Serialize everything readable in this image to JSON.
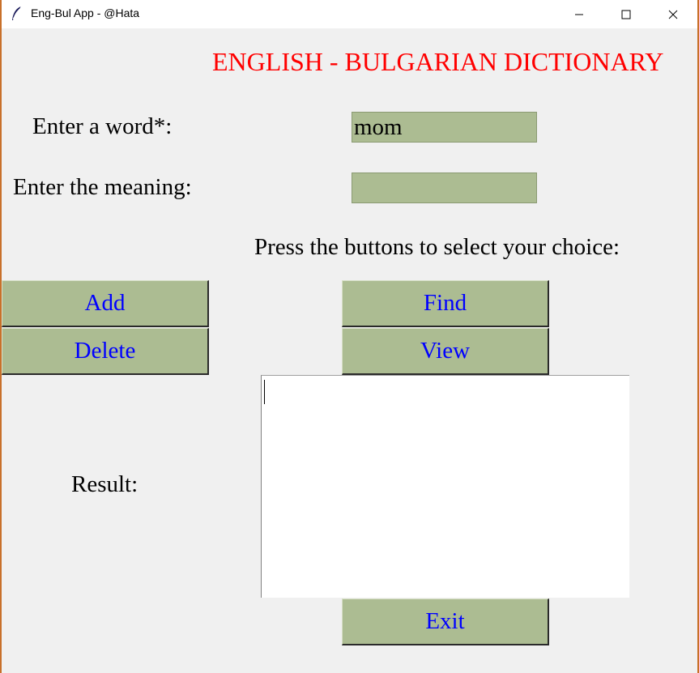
{
  "window": {
    "title": "Eng-Bul App - @Hata",
    "app_icon": "feather-icon",
    "controls": [
      "minimize-icon",
      "maximize-icon",
      "close-icon"
    ]
  },
  "heading": "ENGLISH - BULGARIAN DICTIONARY",
  "form": {
    "word_label": "Enter a word*:",
    "word_value": "mom",
    "meaning_label": "Enter the meaning:",
    "meaning_value": "",
    "choice_prompt": "Press the buttons to select your choice:"
  },
  "buttons": {
    "add": "Add",
    "delete": "Delete",
    "find": "Find",
    "view": "View",
    "exit": "Exit"
  },
  "result": {
    "label": "Result:",
    "text": ""
  },
  "colors": {
    "heading": "#ff0000",
    "button_text": "#0000ff",
    "widget_bg": "#acbc92",
    "window_bg": "#f0f0f0"
  }
}
